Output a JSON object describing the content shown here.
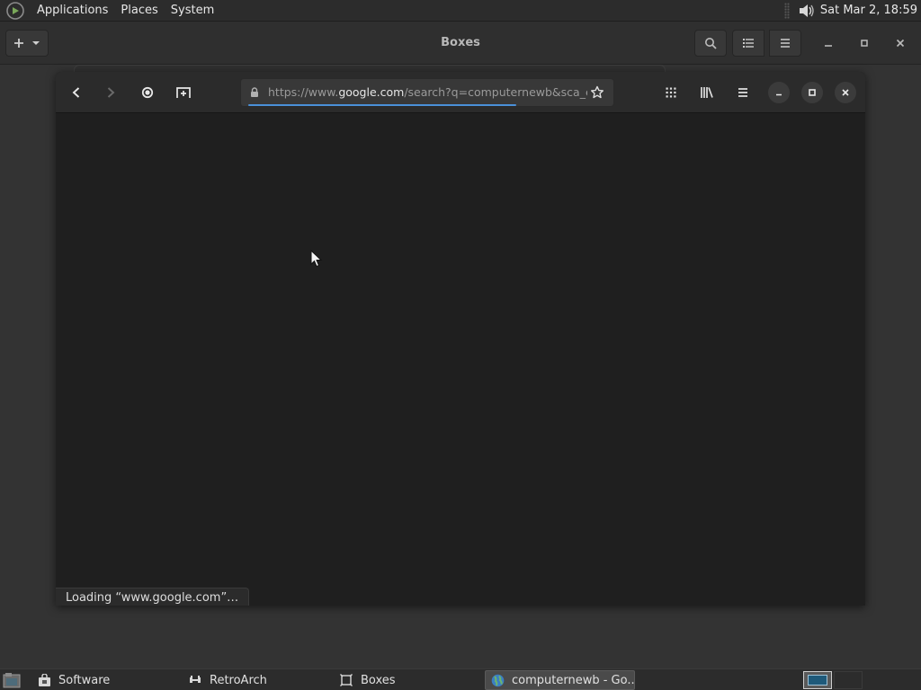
{
  "top_panel": {
    "menus": [
      "Applications",
      "Places",
      "System"
    ],
    "clock": "Sat Mar  2, 18:59"
  },
  "boxes": {
    "title": "Boxes"
  },
  "browser": {
    "url_prefix": "https://www.",
    "url_host": "google.com",
    "url_rest": "/search?q=computernewb&sca_es",
    "load_progress": 0.72,
    "status": "Loading “www.google.com”…"
  },
  "taskbar": {
    "tasks": [
      {
        "label": "Software",
        "icon": "software-icon"
      },
      {
        "label": "RetroArch",
        "icon": "retroarch-icon"
      },
      {
        "label": "Boxes",
        "icon": "boxes-icon"
      },
      {
        "label": "computernewb - Go...",
        "icon": "browser-globe-icon",
        "active": true
      }
    ]
  },
  "colors": {
    "panel_bg": "#2c2c2c",
    "window_bg": "#1f1f1f",
    "accent": "#4a90d9"
  }
}
